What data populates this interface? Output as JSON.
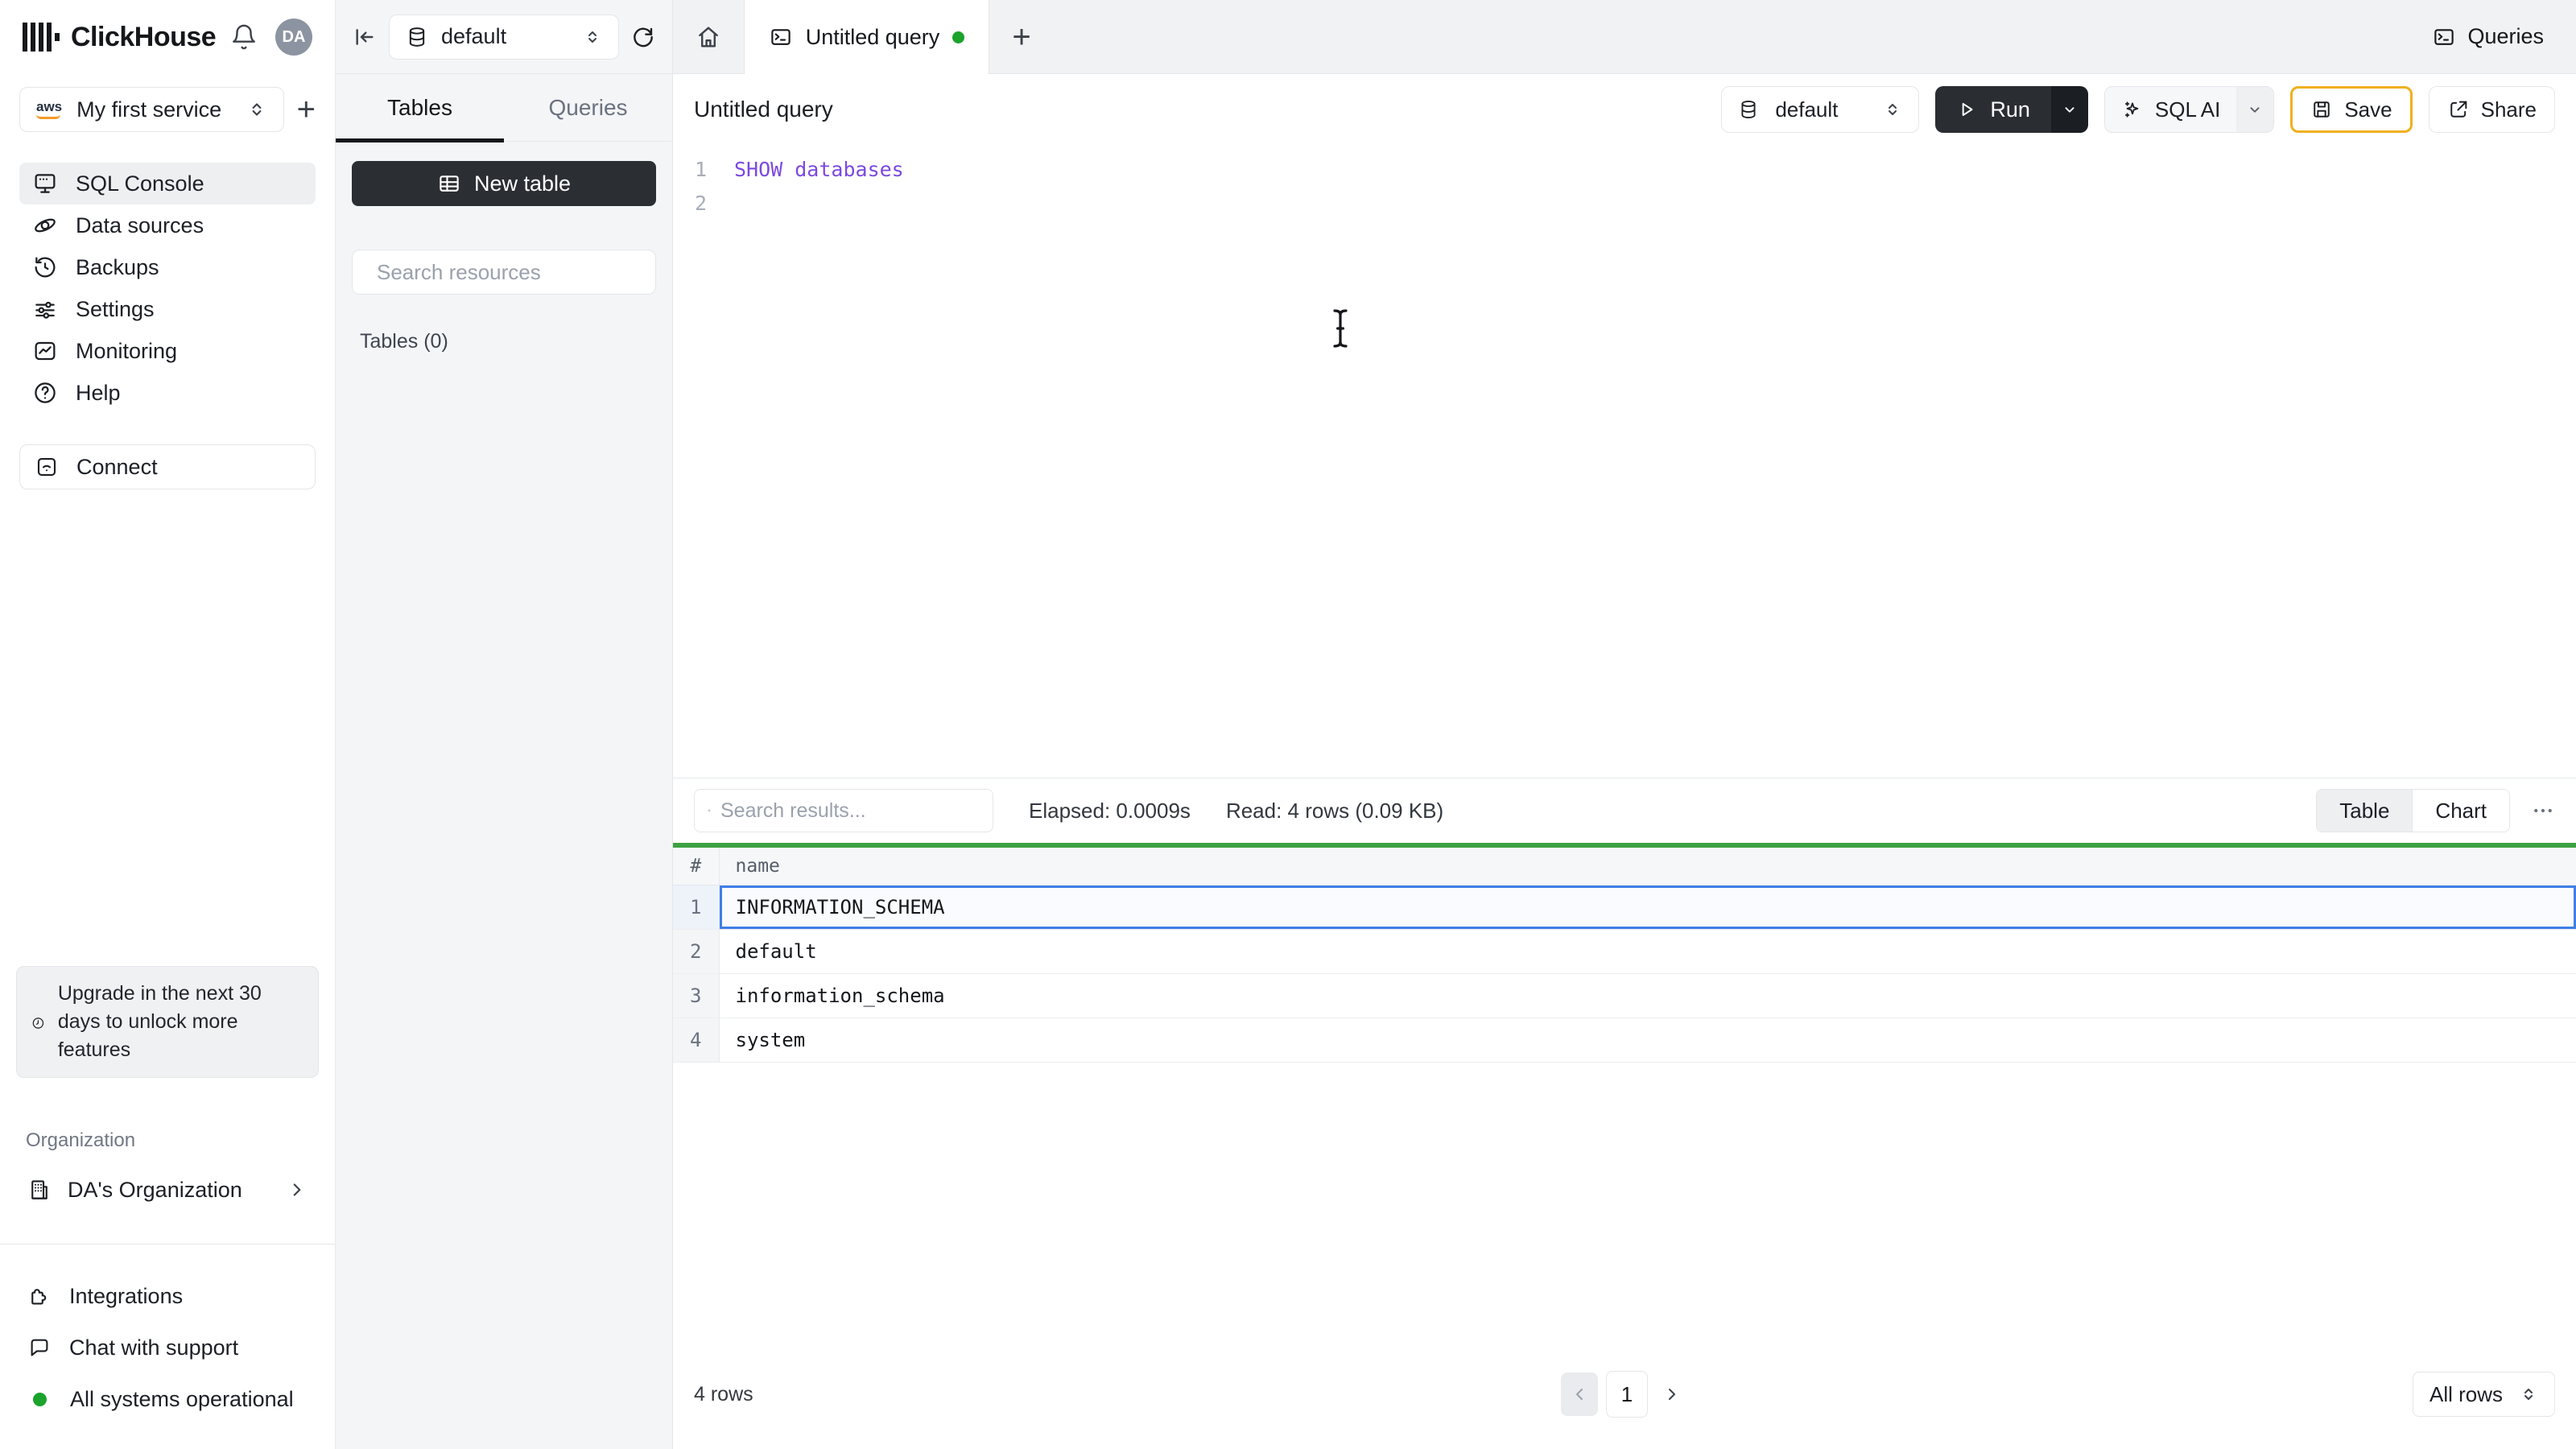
{
  "brand": {
    "name": "ClickHouse",
    "avatar_initials": "DA"
  },
  "service": {
    "name": "My first service"
  },
  "sidebar": {
    "items": [
      {
        "label": "SQL Console"
      },
      {
        "label": "Data sources"
      },
      {
        "label": "Backups"
      },
      {
        "label": "Settings"
      },
      {
        "label": "Monitoring"
      },
      {
        "label": "Help"
      }
    ],
    "connect_label": "Connect",
    "upgrade_notice": "Upgrade in the next 30 days to unlock more features",
    "organization": {
      "heading": "Organization",
      "name": "DA's Organization"
    },
    "footer": {
      "integrations": "Integrations",
      "chat": "Chat with support",
      "status": "All systems operational"
    }
  },
  "tables_panel": {
    "database": "default",
    "tabs": {
      "tables": "Tables",
      "queries": "Queries"
    },
    "new_table": "New table",
    "search_placeholder": "Search resources",
    "count_label": "Tables (0)"
  },
  "tab_bar": {
    "active_tab": "Untitled query"
  },
  "top_right": {
    "queries": "Queries"
  },
  "editor": {
    "title": "Untitled query",
    "database": "default",
    "run": "Run",
    "sql_ai": "SQL AI",
    "save": "Save",
    "share": "Share",
    "lines": [
      {
        "no": "1",
        "code": "SHOW databases"
      },
      {
        "no": "2",
        "code": ""
      }
    ]
  },
  "results": {
    "search_placeholder": "Search results...",
    "elapsed": "Elapsed: 0.0009s",
    "read": "Read: 4 rows (0.09 KB)",
    "toggle": {
      "table": "Table",
      "chart": "Chart"
    },
    "columns": {
      "index": "#",
      "name": "name"
    },
    "rows": [
      {
        "n": "1",
        "name": "INFORMATION_SCHEMA"
      },
      {
        "n": "2",
        "name": "default"
      },
      {
        "n": "3",
        "name": "information_schema"
      },
      {
        "n": "4",
        "name": "system"
      }
    ],
    "selected_row_index": 1,
    "footer": {
      "count": "4 rows",
      "page": "1",
      "page_size": "All rows"
    }
  },
  "colors": {
    "accent_green": "#1ba32c",
    "divider_green": "#3da143",
    "selection_blue": "#3f7fe8",
    "save_border_amber": "#f0b01f",
    "code_purple": "#7b49e0",
    "dark_button": "#2a2d32"
  }
}
